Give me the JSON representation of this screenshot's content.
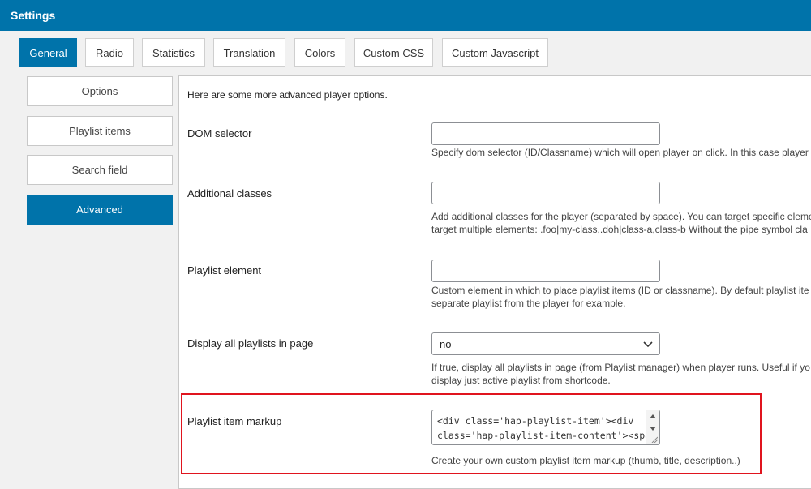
{
  "header": {
    "title": "Settings"
  },
  "tabs": [
    {
      "label": "General",
      "active": true
    },
    {
      "label": "Radio"
    },
    {
      "label": "Statistics"
    },
    {
      "label": "Translation"
    },
    {
      "label": "Colors"
    },
    {
      "label": "Custom CSS"
    },
    {
      "label": "Custom Javascript"
    }
  ],
  "subtabs": [
    {
      "label": "Options"
    },
    {
      "label": "Playlist items"
    },
    {
      "label": "Search field"
    },
    {
      "label": "Advanced",
      "active": true
    }
  ],
  "panel": {
    "intro": "Here are some more advanced player options.",
    "dom_selector": {
      "label": "DOM selector",
      "value": "",
      "description": "Specify dom selector (ID/Classname) which will open player on click. In this case player"
    },
    "additional_classes": {
      "label": "Additional classes",
      "value": "",
      "description_1": "Add additional classes for the player (separated by space). You can target specific eleme",
      "description_2": "target multiple elements: .foo|my-class,.doh|class-a,class-b Without the pipe symbol cla"
    },
    "playlist_element": {
      "label": "Playlist element",
      "value": "",
      "description_1": "Custom element in which to place playlist items (ID or classname). By default playlist ite",
      "description_2": "separate playlist from the player for example."
    },
    "display_all_playlists": {
      "label": "Display all playlists in page",
      "selected": "no",
      "description_1": "If true, display all playlists in page (from Playlist manager) when player runs. Useful if yo",
      "description_2": "display just active playlist from shortcode."
    },
    "playlist_item_markup": {
      "label": "Playlist item markup",
      "line_1": "<div class='hap-playlist-item'><div",
      "line_2": "class='hap-playlist-item-content'><span",
      "description": "Create your own custom playlist item markup (thumb, title, description..)"
    }
  },
  "colors": {
    "accent": "#0073aa",
    "highlight": "#e0141e"
  },
  "icons": {
    "select": "chevron-down-icon",
    "scroll_up": "triangle-up-icon",
    "scroll_down": "triangle-down-icon",
    "resize": "resize-grip-icon"
  }
}
